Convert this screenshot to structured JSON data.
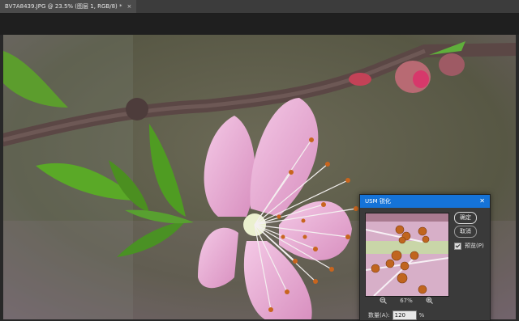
{
  "tab": {
    "title": "BV7A8439.JPG @ 23.5% (图层 1, RGB/8) *",
    "close": "×"
  },
  "dialog": {
    "title": "USM 锐化",
    "close": "✕",
    "ok_label": "确定",
    "cancel_label": "取消",
    "preview_checked": true,
    "preview_label": "预览(P)",
    "zoom_percent": "67%",
    "amount_label": "数量(A):",
    "amount_value": "120",
    "amount_unit": "%"
  },
  "colors": {
    "title_bar": "#1573d8",
    "panel": "#3a3a3a",
    "tab_bar": "#3c3c3c"
  },
  "icons": [
    "close-icon",
    "zoom-out-icon",
    "zoom-in-icon",
    "checkbox-icon"
  ]
}
